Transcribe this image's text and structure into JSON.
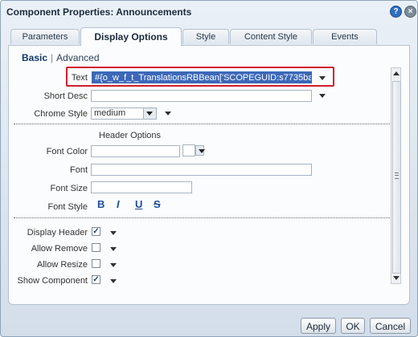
{
  "window": {
    "title": "Component Properties: Announcements",
    "help_icon": "?",
    "close_icon": "×"
  },
  "tabs": [
    {
      "label": "Parameters",
      "active": false
    },
    {
      "label": "Display Options",
      "active": true
    },
    {
      "label": "Style",
      "active": false
    },
    {
      "label": "Content Style",
      "active": false
    },
    {
      "label": "Events",
      "active": false
    }
  ],
  "subtabs": {
    "basic": "Basic",
    "separator": "|",
    "advanced": "Advanced"
  },
  "fields": {
    "text": {
      "label": "Text",
      "value": "#{o_w_f_t_TranslationsRBBean['SCOPEGUID:s7735bad"
    },
    "short_desc": {
      "label": "Short Desc",
      "value": ""
    },
    "chrome_style": {
      "label": "Chrome Style",
      "value": "medium"
    }
  },
  "header_options": {
    "heading": "Header Options",
    "font_color": {
      "label": "Font Color",
      "value": ""
    },
    "font": {
      "label": "Font",
      "value": ""
    },
    "font_size": {
      "label": "Font Size",
      "value": ""
    },
    "font_style": {
      "label": "Font Style",
      "bold": "B",
      "italic": "I",
      "underline": "U",
      "strike": "S"
    }
  },
  "checks": {
    "display_header": {
      "label": "Display Header",
      "checked": true,
      "mark": "✓"
    },
    "allow_remove": {
      "label": "Allow Remove",
      "checked": false,
      "mark": ""
    },
    "allow_resize": {
      "label": "Allow Resize",
      "checked": false,
      "mark": ""
    },
    "show_component": {
      "label": "Show Component",
      "checked": true,
      "mark": "✓"
    }
  },
  "buttons": {
    "apply": "Apply",
    "ok": "OK",
    "cancel": "Cancel"
  },
  "colors": {
    "highlight": "#d0202a",
    "selection": "#3c68b8",
    "accent": "#1f4d9a"
  }
}
